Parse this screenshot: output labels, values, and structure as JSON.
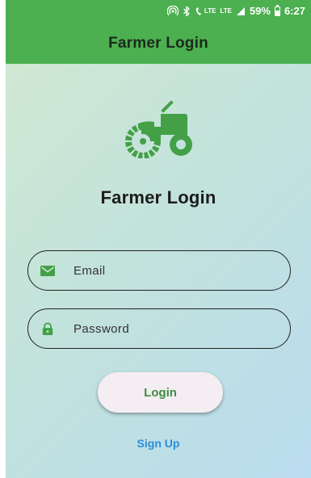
{
  "status_bar": {
    "lte_small": "LTE",
    "lte_label": "LTE",
    "battery": "59%",
    "time": "6:27",
    "icons": [
      "hotspot-icon",
      "bluetooth-icon",
      "lte-call-icon",
      "signal-icon",
      "battery-icon"
    ]
  },
  "app_bar": {
    "title": "Farmer Login"
  },
  "main": {
    "logo_icon": "tractor-icon",
    "heading": "Farmer Login"
  },
  "form": {
    "email": {
      "placeholder": "Email",
      "value": "",
      "icon": "email-icon"
    },
    "password": {
      "placeholder": "Password",
      "value": "",
      "icon": "lock-icon"
    },
    "login_label": "Login",
    "signup_label": "Sign Up"
  },
  "colors": {
    "primary": "#4caf50",
    "icon_green": "#43a047",
    "button_text": "#3c8d3f",
    "link": "#2a8fd8",
    "gradient_start": "#cfe8d2",
    "gradient_end": "#b9dcef"
  }
}
